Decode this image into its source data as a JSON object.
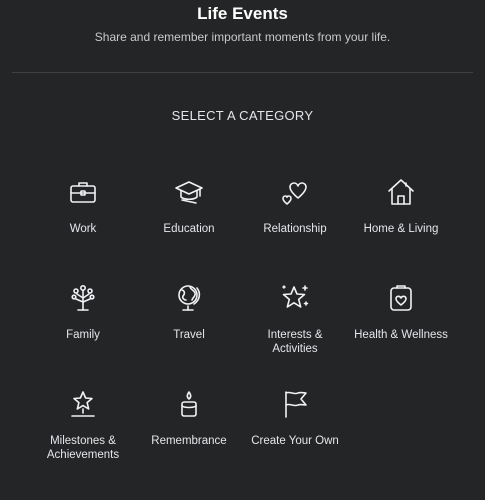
{
  "header": {
    "title": "Life Events",
    "subtitle": "Share and remember important moments from your life."
  },
  "section_label": "SELECT A CATEGORY",
  "categories": [
    {
      "label": "Work",
      "icon": "briefcase-icon"
    },
    {
      "label": "Education",
      "icon": "graduation-cap-icon"
    },
    {
      "label": "Relationship",
      "icon": "hearts-icon"
    },
    {
      "label": "Home & Living",
      "icon": "house-icon"
    },
    {
      "label": "Family",
      "icon": "family-tree-icon"
    },
    {
      "label": "Travel",
      "icon": "globe-icon"
    },
    {
      "label": "Interests & Activities",
      "icon": "star-sparkle-icon"
    },
    {
      "label": "Health & Wellness",
      "icon": "health-clipboard-icon"
    },
    {
      "label": "Milestones & Achievements",
      "icon": "star-trophy-icon"
    },
    {
      "label": "Remembrance",
      "icon": "candle-icon"
    },
    {
      "label": "Create Your Own",
      "icon": "flag-icon"
    }
  ]
}
